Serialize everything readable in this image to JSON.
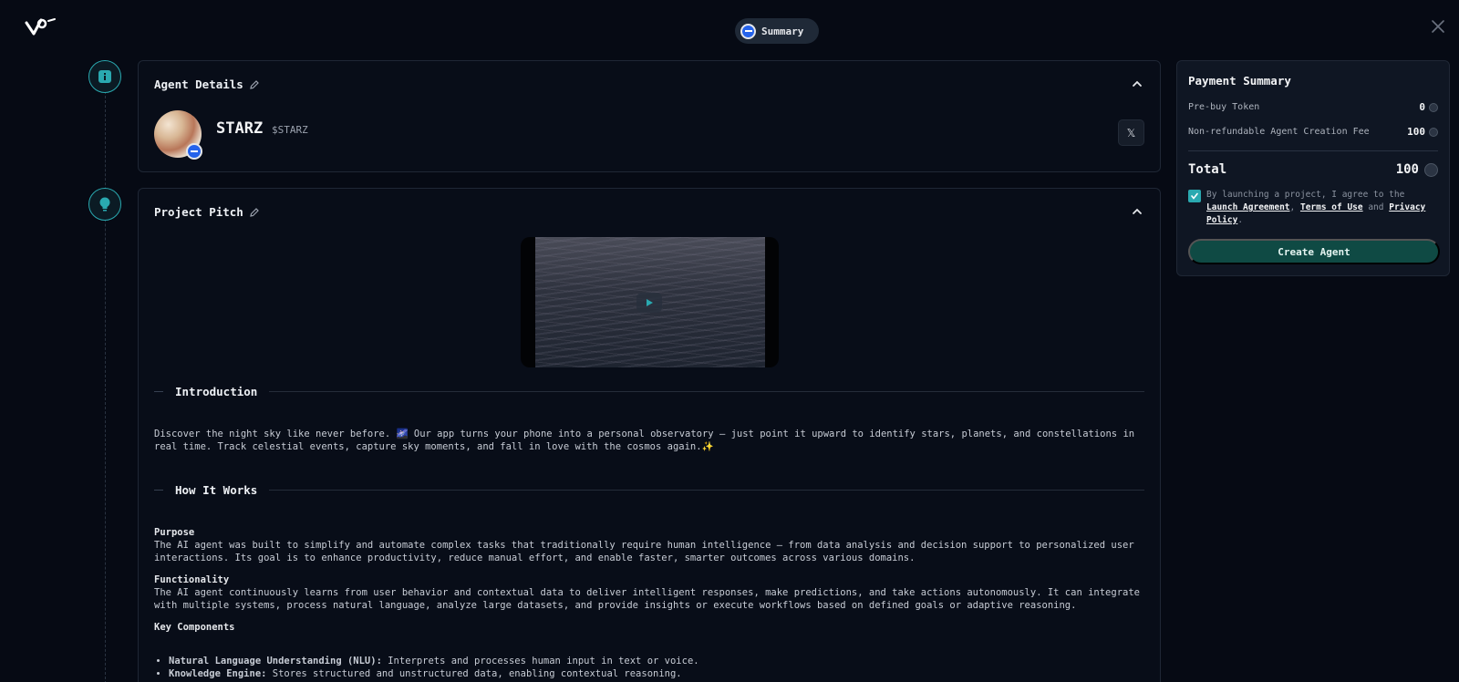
{
  "header": {
    "pill_label": "Summary"
  },
  "agent_details": {
    "title": "Agent Details",
    "name": "STARZ",
    "ticker": "$STARZ",
    "social_label": "𝕏"
  },
  "project_pitch": {
    "title": "Project Pitch",
    "introduction": {
      "heading": "Introduction",
      "text": "Discover the night sky like never before. 🌌 Our app turns your phone into a personal observatory — just point it upward to identify stars, planets, and constellations in real time. Track celestial events, capture sky moments, and fall in love with the cosmos again.✨"
    },
    "how_it_works": {
      "heading": "How It Works",
      "purpose_label": "Purpose",
      "purpose_text": "The AI agent was built to simplify and automate complex tasks that traditionally require human intelligence — from data analysis and decision support to personalized user interactions. Its goal is to enhance productivity, reduce manual effort, and enable faster, smarter outcomes across various domains.",
      "functionality_label": "Functionality",
      "functionality_text": "The AI agent continuously learns from user behavior and contextual data to deliver intelligent responses, make predictions, and take actions autonomously. It can integrate with multiple systems, process natural language, analyze large datasets, and provide insights or execute workflows based on defined goals or adaptive reasoning.",
      "components_label": "Key Components",
      "components": [
        {
          "name": "Natural Language Understanding (NLU):",
          "desc": " Interprets and processes human input in text or voice."
        },
        {
          "name": "Knowledge Engine:",
          "desc": " Stores structured and unstructured data, enabling contextual reasoning."
        }
      ]
    }
  },
  "payment": {
    "title": "Payment Summary",
    "prebuy_label": "Pre-buy Token",
    "prebuy_value": "0",
    "fee_label": "Non-refundable Agent Creation Fee",
    "fee_value": "100",
    "total_label": "Total",
    "total_value": "100",
    "agree_prefix": "By launching a project, I agree to the ",
    "launch_agreement": "Launch Agreement",
    "comma": ", ",
    "terms": "Terms of Use",
    "and": " and ",
    "privacy": "Privacy Policy",
    "period": ".",
    "create_button": "Create Agent"
  }
}
